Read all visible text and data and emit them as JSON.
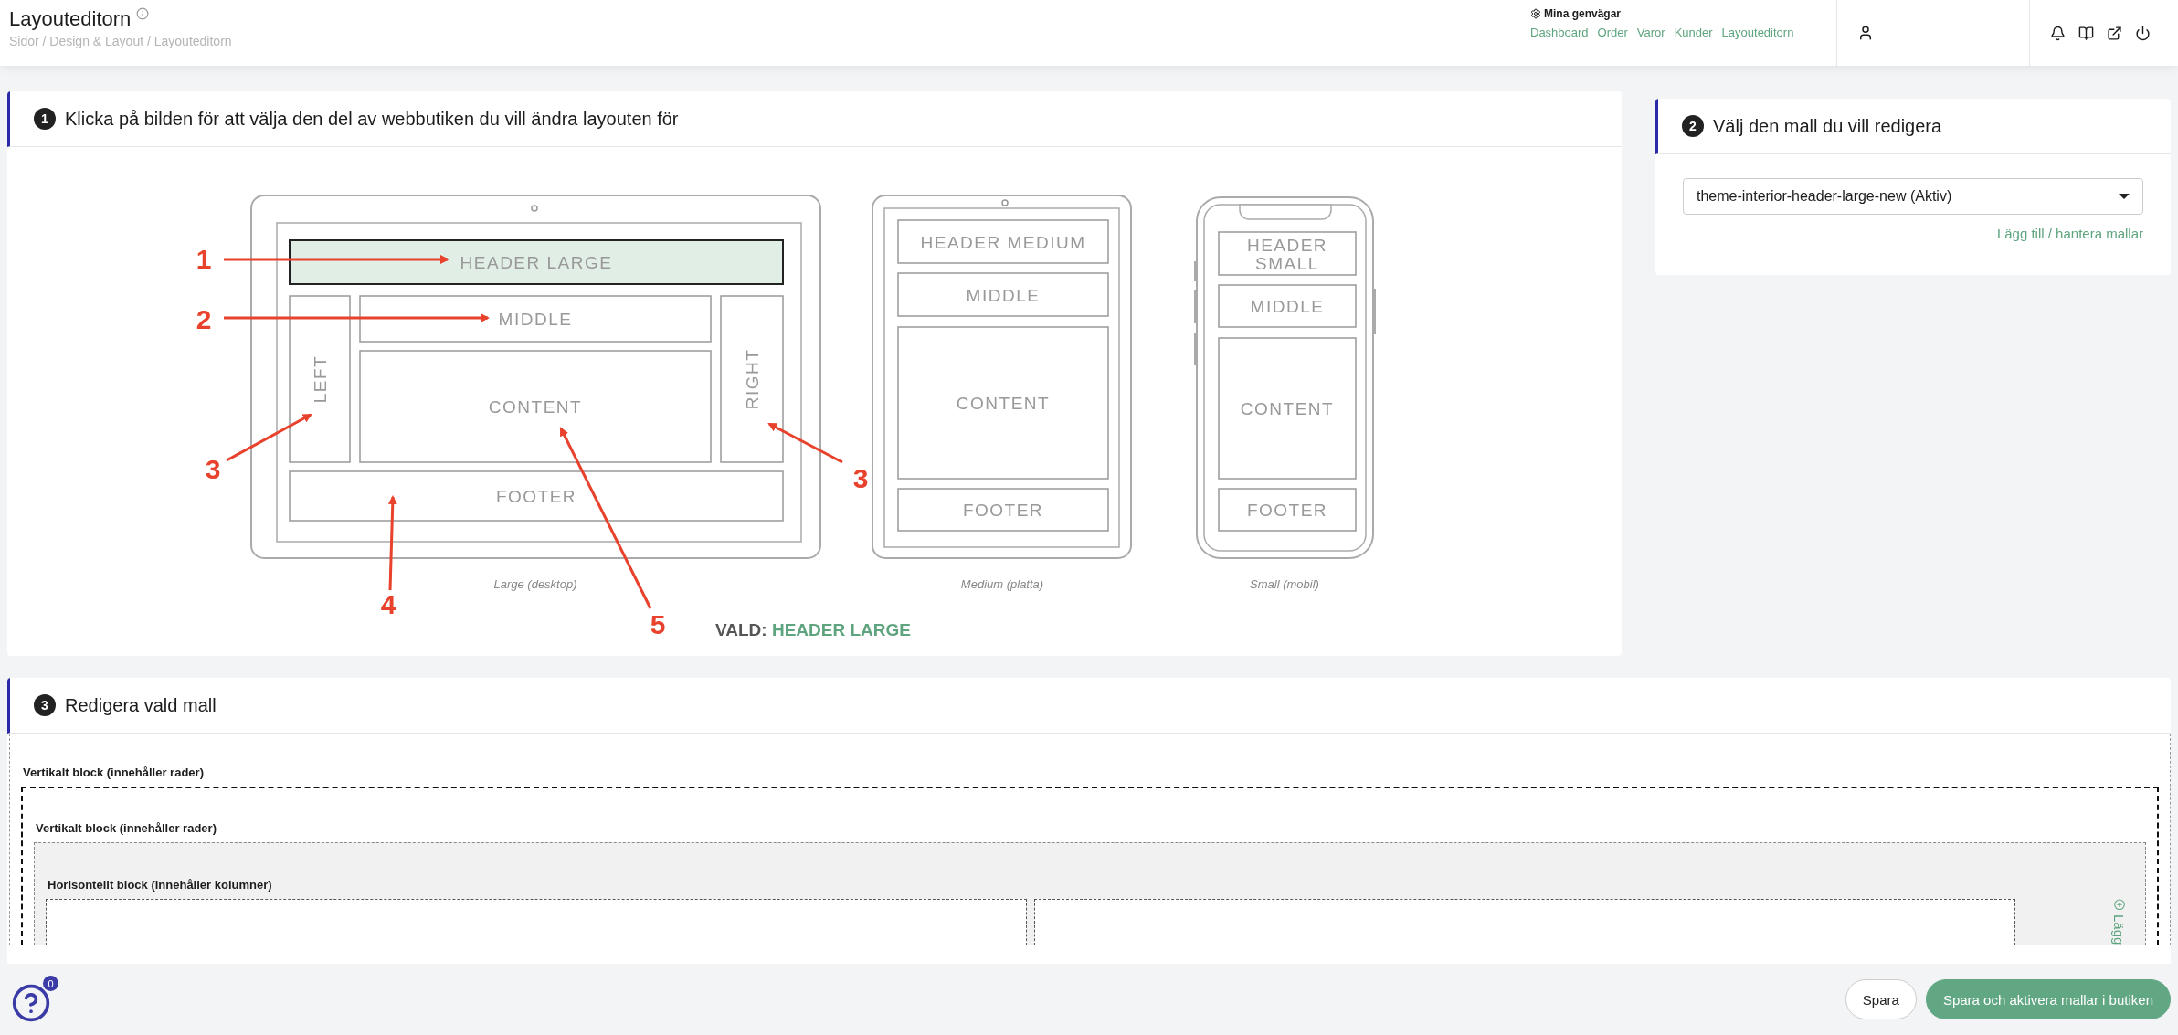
{
  "page": {
    "title": "Layouteditorn",
    "breadcrumb": "Sidor / Design & Layout / Layouteditorn"
  },
  "shortcuts": {
    "title": "Mina genvägar",
    "links": [
      "Dashboard",
      "Order",
      "Varor",
      "Kunder",
      "Layouteditorn"
    ]
  },
  "layout_picker": {
    "step": "1",
    "title": "Klicka på bilden för att välja den del av webbutiken du vill ändra layouten för",
    "devices": [
      {
        "kind": "desktop",
        "label": "Large (desktop)",
        "regions": [
          {
            "name": "HEADER LARGE",
            "selected": true
          },
          {
            "name": "LEFT",
            "selected": false
          },
          {
            "name": "MIDDLE",
            "selected": false
          },
          {
            "name": "CONTENT",
            "selected": false
          },
          {
            "name": "RIGHT",
            "selected": false
          },
          {
            "name": "FOOTER",
            "selected": false
          }
        ]
      },
      {
        "kind": "tablet",
        "label": "Medium (platta)",
        "regions": [
          {
            "name": "HEADER MEDIUM",
            "selected": false
          },
          {
            "name": "MIDDLE",
            "selected": false
          },
          {
            "name": "CONTENT",
            "selected": false
          },
          {
            "name": "FOOTER",
            "selected": false
          }
        ]
      },
      {
        "kind": "phone",
        "label": "Small (mobil)",
        "regions": [
          {
            "name": "HEADER SMALL",
            "selected": false
          },
          {
            "name": "MIDDLE",
            "selected": false
          },
          {
            "name": "CONTENT",
            "selected": false
          },
          {
            "name": "FOOTER",
            "selected": false
          }
        ]
      }
    ],
    "callouts": [
      "1",
      "2",
      "3",
      "3",
      "4",
      "5"
    ],
    "selection_label": "VALD:",
    "selection_value": "HEADER LARGE"
  },
  "template_picker": {
    "step": "2",
    "title": "Välj den mall du vill redigera",
    "value": "theme-interior-header-large-new (Aktiv)",
    "link": "Lägg till / hantera mallar"
  },
  "editor": {
    "step": "3",
    "title": "Redigera vald mall",
    "add_label": "Lägg",
    "blocks": [
      {
        "kind": "vertical",
        "label": "Vertikalt block (innehåller rader)",
        "selected": true,
        "children": [
          {
            "kind": "vertical",
            "label": "Vertikalt block (innehåller rader)",
            "selected": false,
            "children": [
              {
                "kind": "horizontal",
                "label": "Horisontellt block (innehåller kolumner)",
                "children": [
                  {
                    "kind": "vertical",
                    "selected": false
                  },
                  {
                    "kind": "vertical",
                    "selected": false
                  }
                ]
              }
            ]
          }
        ]
      }
    ]
  },
  "footer": {
    "help_count": "0",
    "buttons": [
      {
        "kind": "secondary",
        "label": "Spara"
      },
      {
        "kind": "primary",
        "label": "Spara och aktivera mallar i butiken"
      }
    ]
  }
}
